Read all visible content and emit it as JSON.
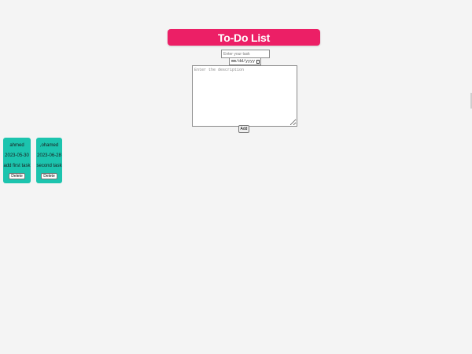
{
  "header": {
    "title": "To-Do List"
  },
  "form": {
    "task_placeholder": "Enter your task",
    "date_placeholder": "mm/dd/yyyy",
    "description_placeholder": "Enter the description",
    "add_label": "Add"
  },
  "tasks": [
    {
      "name": "ahmed",
      "date": "2023-05-30",
      "description": "add first task",
      "delete_label": "Delete"
    },
    {
      "name": ",ohamed",
      "date": "2023-06-28",
      "description": "second task",
      "delete_label": "Delete"
    }
  ],
  "colors": {
    "header_bg": "#ec1f66",
    "card_bg": "#1cc4ae",
    "page_bg": "#f4f4f4"
  }
}
